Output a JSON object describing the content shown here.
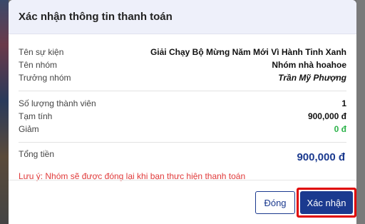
{
  "dialog": {
    "title": "Xác nhận thông tin thanh toán"
  },
  "info": {
    "event_label": "Tên sự kiện",
    "event_value": "Giải Chạy Bộ Mừng Năm Mới Vì Hành Tinh Xanh",
    "team_label": "Tên nhóm",
    "team_value": "Nhóm nhà hoahoe",
    "leader_label": "Trưởng nhóm",
    "leader_value": "Trần Mỹ Phượng"
  },
  "pricing": {
    "members_label": "Số lượng thành viên",
    "members_value": "1",
    "subtotal_label": "Tạm tính",
    "subtotal_value": "900,000 đ",
    "discount_label": "Giảm",
    "discount_value": "0 đ",
    "total_label": "Tổng tiền",
    "total_value": "900,000 đ"
  },
  "note": "Lưu ý: Nhóm sẽ được đóng lại khi bạn thực hiện thanh toán",
  "buttons": {
    "close_label": "Đóng",
    "confirm_label": "Xác nhận"
  },
  "colors": {
    "primary": "#1b3a8f",
    "discount": "#2cb34a",
    "warning": "#e03a3a",
    "highlight": "#e00000"
  }
}
